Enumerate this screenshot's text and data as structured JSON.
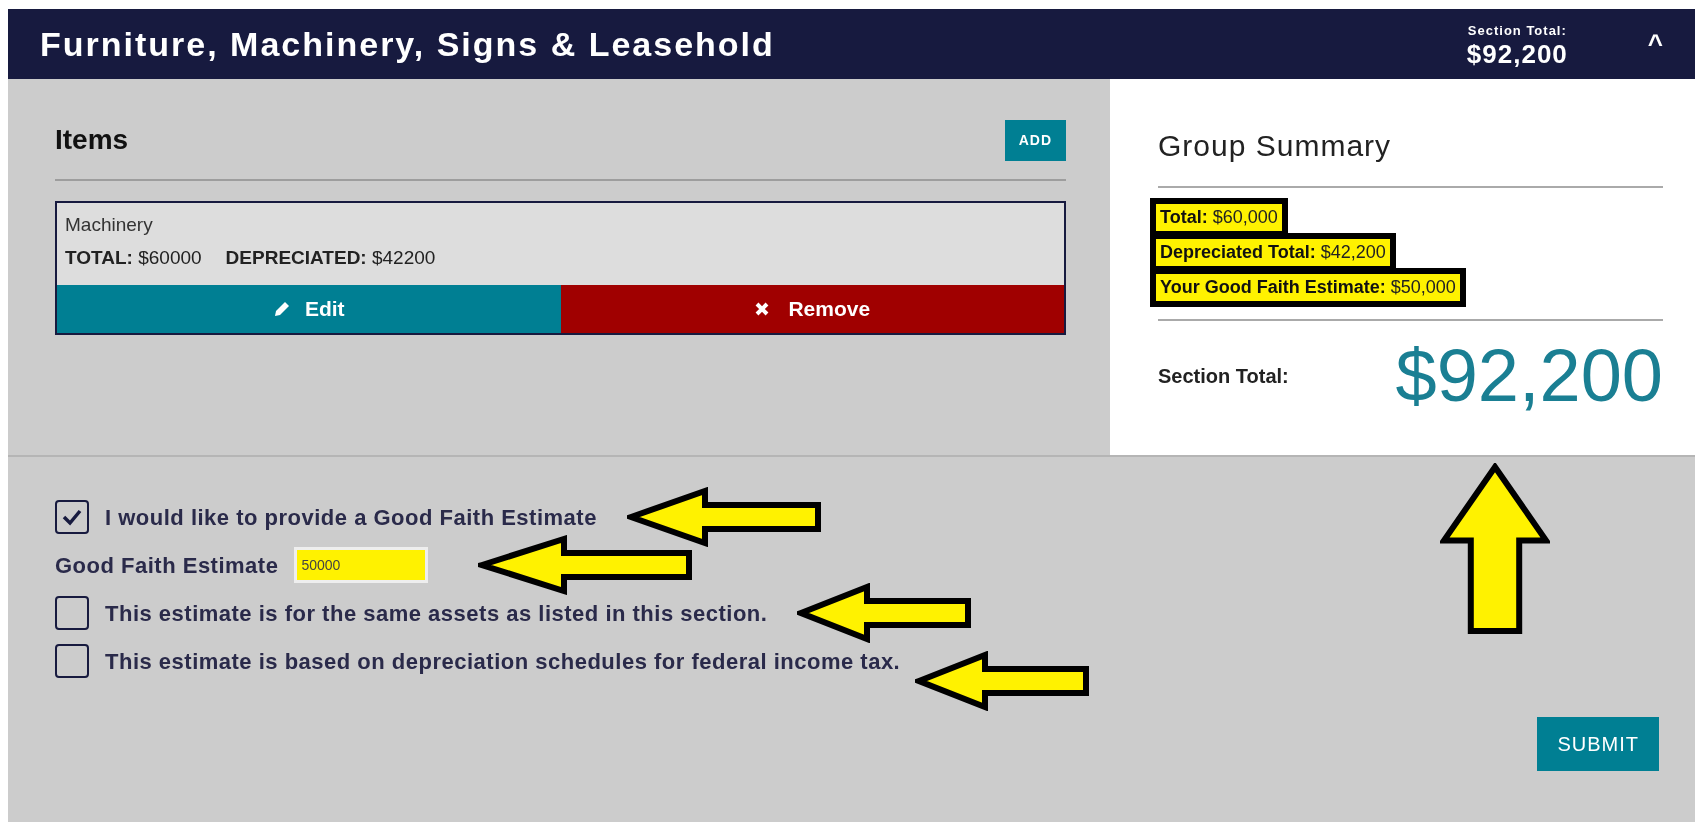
{
  "header": {
    "title": "Furniture, Machinery, Signs & Leasehold",
    "section_total_label": "Section Total:",
    "section_total": "$92,200",
    "collapse_glyph": "^",
    "expanded": true
  },
  "items_panel": {
    "title": "Items",
    "add_button": "ADD",
    "items": [
      {
        "name": "Machinery",
        "total_label": "TOTAL:",
        "total": "$60000",
        "depreciated_label": "DEPRECIATED:",
        "depreciated": "$42200",
        "edit_button": "Edit",
        "remove_button": "Remove"
      }
    ]
  },
  "summary": {
    "title": "Group Summary",
    "lines": [
      {
        "label": "Total:",
        "value": "$60,000",
        "highlighted": true
      },
      {
        "label": "Depreciated Total:",
        "value": "$42,200",
        "highlighted": true
      },
      {
        "label": "Your Good Faith Estimate:",
        "value": "$50,000",
        "highlighted": true
      }
    ],
    "section_total_label": "Section Total:",
    "section_total": "$92,200",
    "arrow": {
      "kind": "up"
    }
  },
  "form": {
    "rows": [
      {
        "kind": "checkbox",
        "label": "I would like to provide a Good Faith Estimate",
        "checked": true,
        "arrow": {
          "kind": "left"
        }
      },
      {
        "kind": "field",
        "label": "Good Faith Estimate",
        "value": "50000",
        "highlighted": true,
        "arrow": {
          "kind": "left"
        }
      },
      {
        "kind": "checkbox",
        "label": "This estimate is for the same assets as listed in this section.",
        "checked": false,
        "arrow": {
          "kind": "left"
        }
      },
      {
        "kind": "checkbox",
        "label": "This estimate is based on depreciation schedules for federal income tax.",
        "checked": false,
        "arrow": {
          "kind": "left"
        }
      }
    ],
    "submit_button": "SUBMIT"
  }
}
